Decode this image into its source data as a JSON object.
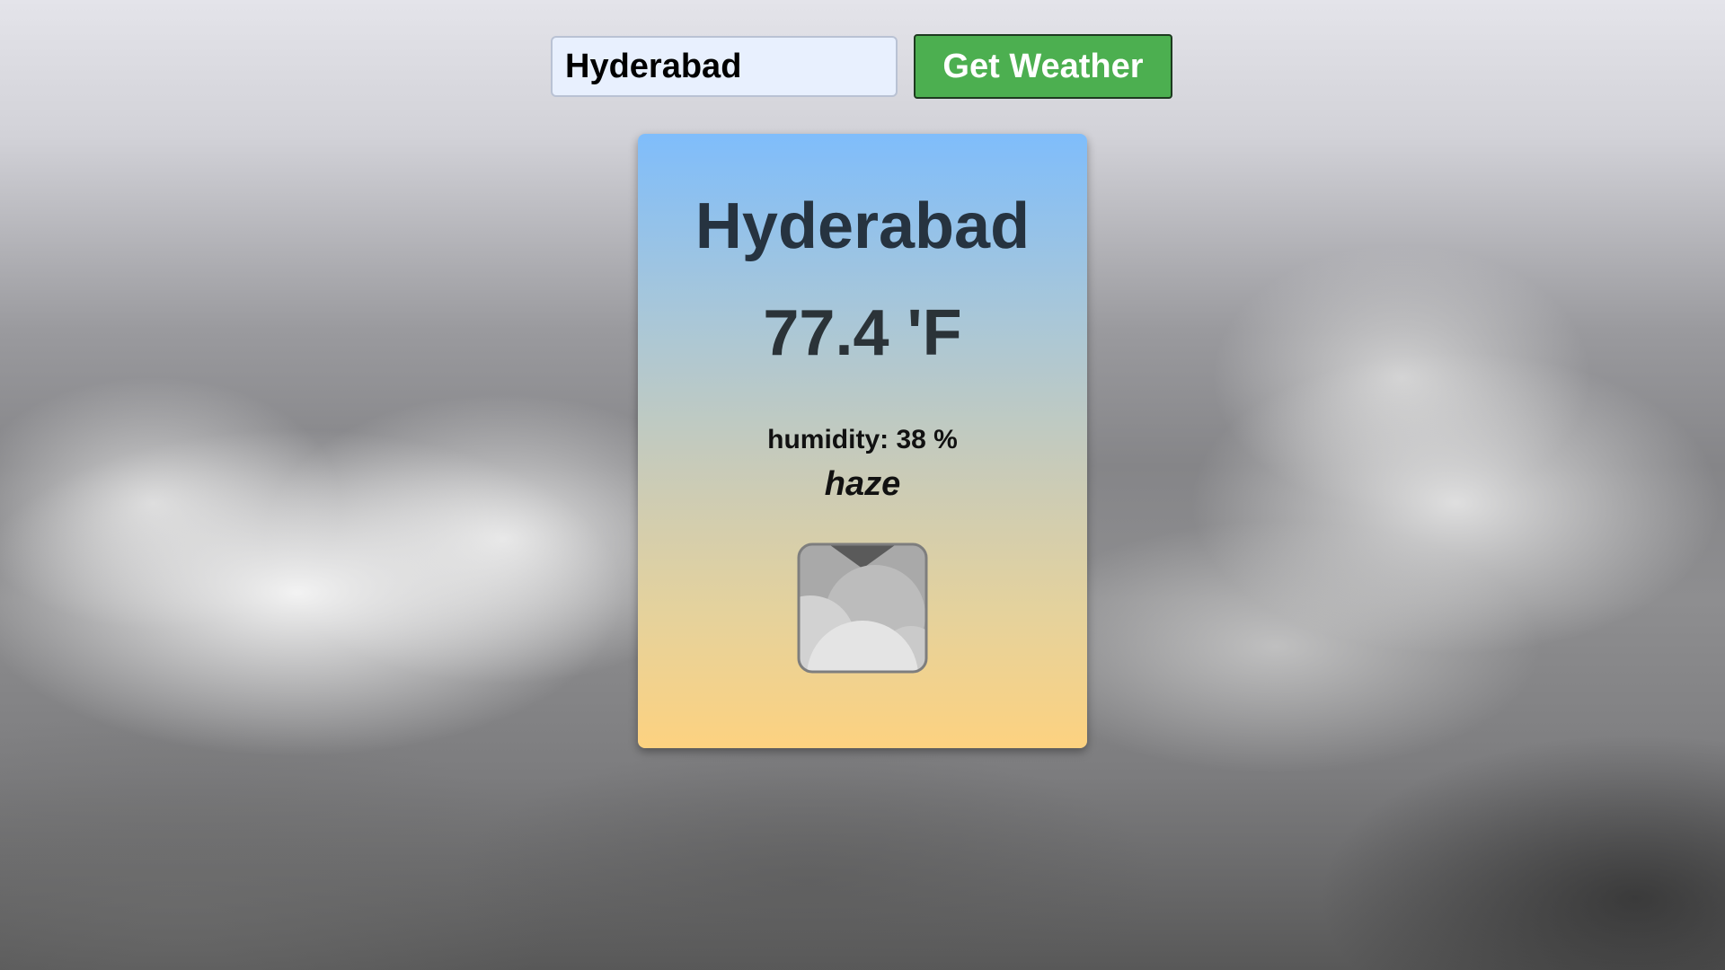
{
  "search": {
    "value": "Hyderabad",
    "button_label": "Get Weather"
  },
  "weather": {
    "city": "Hyderabad",
    "temperature": "77.4 'F",
    "humidity": "humidity: 38 %",
    "description": "haze",
    "icon": "haze-cloud-icon"
  },
  "colors": {
    "button": "#4caf50",
    "input_bg": "#e8f0fe",
    "card_top": "#7fbdfb",
    "card_bottom": "#fdd280",
    "title_text": "#263340"
  }
}
